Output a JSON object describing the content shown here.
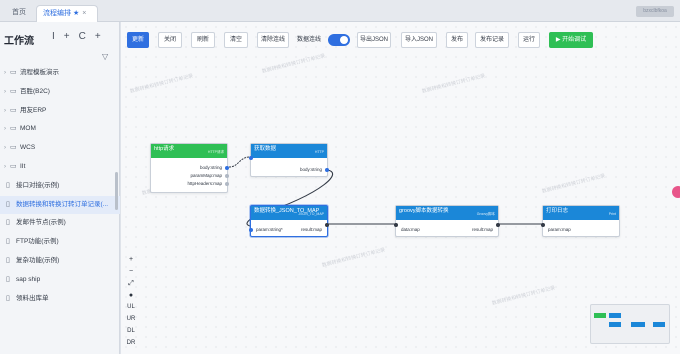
{
  "browser": {
    "home_tab": "首页",
    "active_tab": "流程编排",
    "user_badge": "bzxclbfkoa"
  },
  "sidebar": {
    "title": "工作流",
    "tools": [
      "I",
      "+",
      "C",
      "+"
    ],
    "filter_icon": "filter-icon",
    "items": [
      {
        "label": "流程模板演示",
        "type": "folder"
      },
      {
        "label": "百胜(B2C)",
        "type": "folder"
      },
      {
        "label": "用友ERP",
        "type": "folder"
      },
      {
        "label": "MOM",
        "type": "folder"
      },
      {
        "label": "WCS",
        "type": "folder"
      },
      {
        "label": "IIt",
        "type": "folder"
      },
      {
        "label": "接口对接(示例)",
        "type": "file"
      },
      {
        "label": "数据转换和转换订转订单记录(...",
        "type": "file",
        "active": true
      },
      {
        "label": "发邮件节点(示例)",
        "type": "file"
      },
      {
        "label": "FTP功能(示例)",
        "type": "file"
      },
      {
        "label": "复杂功能(示例)",
        "type": "file"
      },
      {
        "label": "sap ship",
        "type": "file"
      },
      {
        "label": "领料出库单",
        "type": "file"
      }
    ]
  },
  "toolbar": {
    "save": "更新",
    "close": "关闭",
    "refresh": "刷新",
    "clear": "清空",
    "clear_lines": "清除连线",
    "data_line_label": "数据连线",
    "data_line_on": true,
    "export_json": "导出JSON",
    "import_json": "导入JSON",
    "publish": "发布",
    "publish_log": "发布记录",
    "run": "运行",
    "start_debug": "▶ 开始调试"
  },
  "nodes": {
    "http": {
      "title": "http请求",
      "subtitle": "HTTP请求",
      "ports_out": [
        "body:string",
        "paramMap:map",
        "httpHeaders:map"
      ]
    },
    "fetch": {
      "title": "获取数据",
      "subtitle": "HTTP",
      "ports_out": [
        "body:string"
      ]
    },
    "convert": {
      "title": "数据转换_JSON_TO_MAP",
      "subtitle": "JSON_TO_MAP",
      "port_in": "param:string*",
      "port_out": "result:map"
    },
    "groovy": {
      "title": "groovy脚本数据转换",
      "subtitle": "Groovy脚本",
      "port_in": "data:map",
      "port_out": "result:map"
    },
    "print": {
      "title": "打印日志",
      "subtitle": "Print",
      "port_in": "param:map"
    }
  },
  "controls": [
    "+",
    "−",
    "⤢",
    "●",
    "UL",
    "UR",
    "DL",
    "DR"
  ],
  "watermark": "数据转换和转换订转订单记录",
  "colors": {
    "primary": "#2f6fe0",
    "green": "#2fbf55",
    "node_blue": "#1b87d8"
  }
}
